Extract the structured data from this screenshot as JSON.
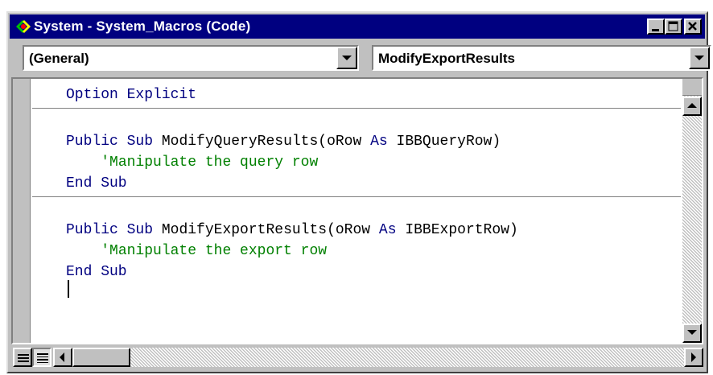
{
  "window": {
    "title": "System - System_Macros (Code)"
  },
  "combos": {
    "object": "(General)",
    "procedure": "ModifyExportResults"
  },
  "code": {
    "line1": "Option Explicit",
    "sub1_kw_public": "Public",
    "sub1_kw_sub": "Sub",
    "sub1_name": "ModifyQueryResults(oRow",
    "sub1_kw_as": "As",
    "sub1_type": "IBBQueryRow)",
    "sub1_comment": "'Manipulate the query row",
    "sub1_end": "End Sub",
    "sub2_kw_public": "Public",
    "sub2_kw_sub": "Sub",
    "sub2_name": "ModifyExportResults(oRow",
    "sub2_kw_as": "As",
    "sub2_type": "IBBExportRow)",
    "sub2_comment": "'Manipulate the export row",
    "sub2_end": "End Sub"
  },
  "colors": {
    "titlebar": "#000080",
    "keyword": "#000080",
    "comment": "#008000"
  },
  "icons": {
    "app": "vba-project-icon",
    "minimize": "minimize-icon",
    "maximize": "maximize-icon",
    "close": "close-icon"
  }
}
